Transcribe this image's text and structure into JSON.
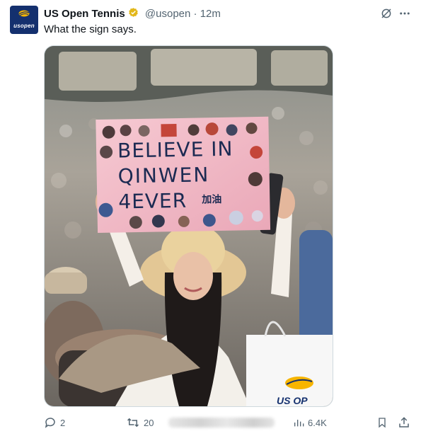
{
  "tweet": {
    "author_name": "US Open Tennis",
    "handle": "@usopen",
    "time": "· 12m",
    "text": "What the sign says.",
    "avatar_text": "usopen",
    "media_image": {
      "sign_lines": [
        "BELIEVE IN",
        "QINWEN",
        "4EVER"
      ],
      "sign_chinese": "加油",
      "bag_text": "US OP"
    }
  },
  "footer": {
    "replies": "2",
    "retweets": "20",
    "views": "6.4K"
  },
  "colors": {
    "brand_navy": "#14306e",
    "brand_gold": "#f7b500",
    "verified_gold": "#e2b719",
    "text_primary": "#0f1419",
    "text_muted": "#536471"
  },
  "icons": [
    "usopen-logo-icon",
    "verified-badge-icon",
    "grok-icon",
    "more-icon",
    "reply-icon",
    "retweet-icon",
    "views-icon",
    "bookmark-icon",
    "share-icon"
  ]
}
